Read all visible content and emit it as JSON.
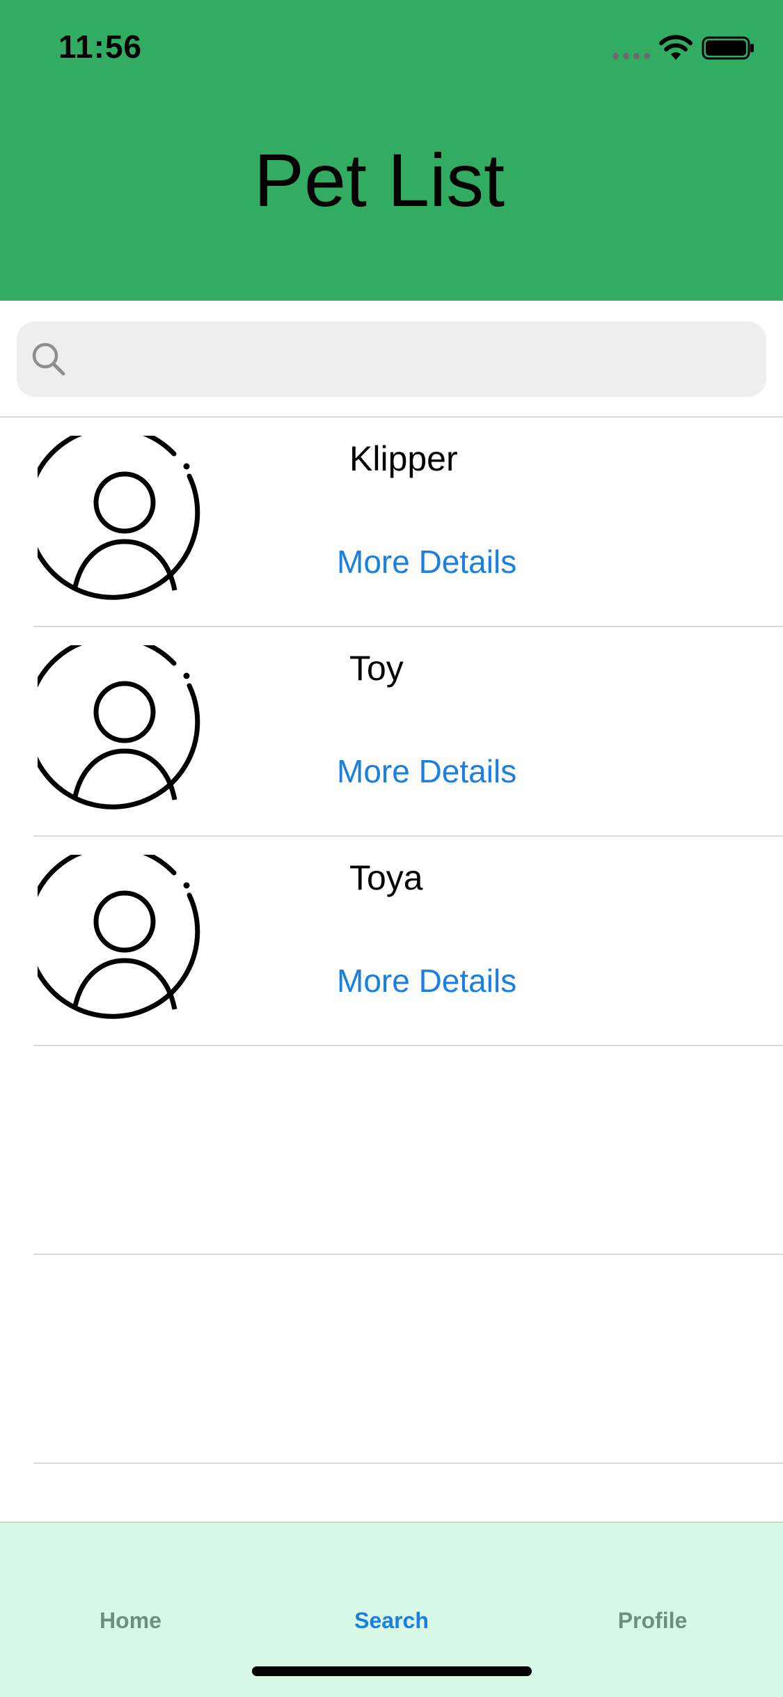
{
  "status_bar": {
    "time": "11:56"
  },
  "header": {
    "title": "Pet List"
  },
  "search": {
    "placeholder": "",
    "value": ""
  },
  "pets": [
    {
      "name": "Klipper",
      "link_label": "More Details"
    },
    {
      "name": "Toy",
      "link_label": "More Details"
    },
    {
      "name": "Toya",
      "link_label": "More Details"
    }
  ],
  "tabs": [
    {
      "label": "Home",
      "active": false
    },
    {
      "label": "Search",
      "active": true
    },
    {
      "label": "Profile",
      "active": false
    }
  ],
  "colors": {
    "header_bg": "#33ac63",
    "tabbar_bg": "#d8f8e5",
    "link": "#1a7fe0",
    "active_tab": "#1a7fe0",
    "inactive_tab": "#6f8f7d"
  },
  "icons": [
    "wifi-icon",
    "battery-icon",
    "search-icon",
    "avatar-icon"
  ]
}
